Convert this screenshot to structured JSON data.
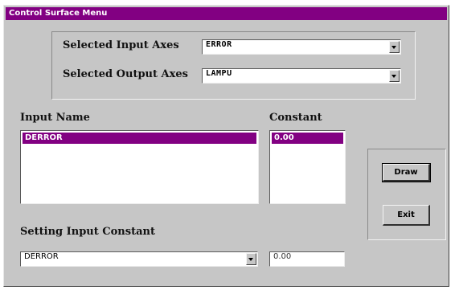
{
  "window": {
    "title": "Control Surface Menu"
  },
  "axes": {
    "input_label": "Selected Input Axes",
    "input_value": "ERROR",
    "output_label": "Selected Output Axes",
    "output_value": "LAMPU"
  },
  "input_list": {
    "header": "Input Name",
    "items": [
      "DERROR"
    ]
  },
  "constant_list": {
    "header": "Constant",
    "items": [
      "0.00"
    ]
  },
  "buttons": {
    "draw": "Draw",
    "exit": "Exit"
  },
  "setting": {
    "label": "Setting Input Constant",
    "selected_input": "DERROR",
    "constant_value": "0.00"
  },
  "colors": {
    "title_bar": "#820082",
    "selection": "#820082",
    "face": "#c6c6c6"
  }
}
